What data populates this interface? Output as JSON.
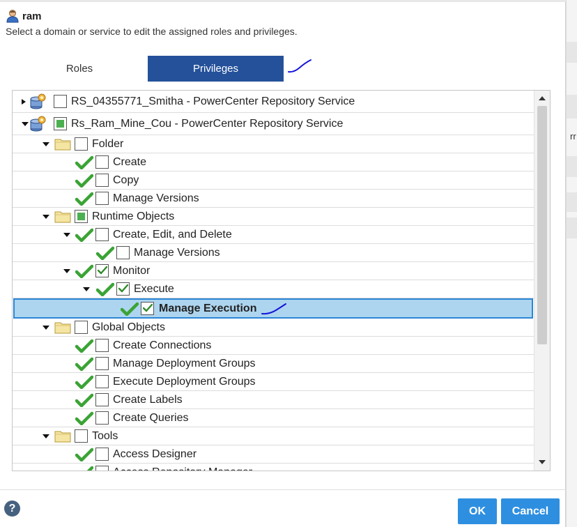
{
  "dialog": {
    "user_name": "ram",
    "subtitle": "Select a domain or service to edit the assigned roles and privileges."
  },
  "tabs": {
    "roles": "Roles",
    "privileges": "Privileges",
    "active": "Privileges"
  },
  "tree": {
    "rows": [
      {
        "label": "RS_04355771_Smitha - PowerCenter Repository Service",
        "state": "unchecked",
        "expanded": false
      },
      {
        "label": "Rs_Ram_Mine_Cou - PowerCenter Repository Service",
        "state": "partial",
        "expanded": true
      },
      {
        "label": "Folder",
        "state": "unchecked",
        "expanded": true
      },
      {
        "label": "Create",
        "state": "unchecked",
        "granted": true
      },
      {
        "label": "Copy",
        "state": "unchecked",
        "granted": true
      },
      {
        "label": "Manage Versions",
        "state": "unchecked",
        "granted": true
      },
      {
        "label": "Runtime Objects",
        "state": "partial",
        "expanded": true
      },
      {
        "label": "Create, Edit, and Delete",
        "state": "unchecked",
        "expanded": true,
        "granted": true
      },
      {
        "label": "Manage Versions",
        "state": "unchecked",
        "granted": true
      },
      {
        "label": "Monitor",
        "state": "checked",
        "expanded": true,
        "granted": true
      },
      {
        "label": "Execute",
        "state": "checked",
        "expanded": true,
        "granted": true
      },
      {
        "label": "Manage Execution",
        "state": "checked",
        "granted": true,
        "selected": true
      },
      {
        "label": "Global Objects",
        "state": "unchecked",
        "expanded": true
      },
      {
        "label": "Create Connections",
        "state": "unchecked",
        "granted": true
      },
      {
        "label": "Manage Deployment Groups",
        "state": "unchecked",
        "granted": true
      },
      {
        "label": "Execute Deployment Groups",
        "state": "unchecked",
        "granted": true
      },
      {
        "label": "Create Labels",
        "state": "unchecked",
        "granted": true
      },
      {
        "label": "Create Queries",
        "state": "unchecked",
        "granted": true
      },
      {
        "label": "Tools",
        "state": "unchecked",
        "expanded": true
      },
      {
        "label": "Access Designer",
        "state": "unchecked",
        "granted": true
      },
      {
        "label": "Access Repository Manager",
        "state": "unchecked",
        "granted": true
      }
    ]
  },
  "footer": {
    "help_glyph": "?",
    "ok": "OK",
    "cancel": "Cancel"
  },
  "background": {
    "partial_text": "rr"
  },
  "colors": {
    "tab_active": "#24519a",
    "button": "#2e8fe0",
    "selection": "#add5ef",
    "check_green": "#3aa334"
  }
}
